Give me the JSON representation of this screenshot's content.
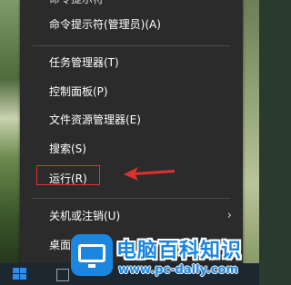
{
  "menu": {
    "items": [
      {
        "label": "命令提示符(管理员)(A)"
      },
      {
        "label": "任务管理器(T)"
      },
      {
        "label": "控制面板(P)"
      },
      {
        "label": "文件资源管理器(E)"
      },
      {
        "label": "搜索(S)"
      },
      {
        "label": "运行(R)"
      },
      {
        "label": "关机或注销(U)"
      },
      {
        "label": "桌面"
      }
    ],
    "submenu_chevron": "›"
  },
  "watermark": {
    "title": "电脑百科知识",
    "url": "www.pc-daily.com"
  },
  "colors": {
    "menu_bg": "#2b2b2b",
    "menu_text": "#ffffff",
    "highlight": "#e03030",
    "watermark_blue": "#1a86e0"
  }
}
